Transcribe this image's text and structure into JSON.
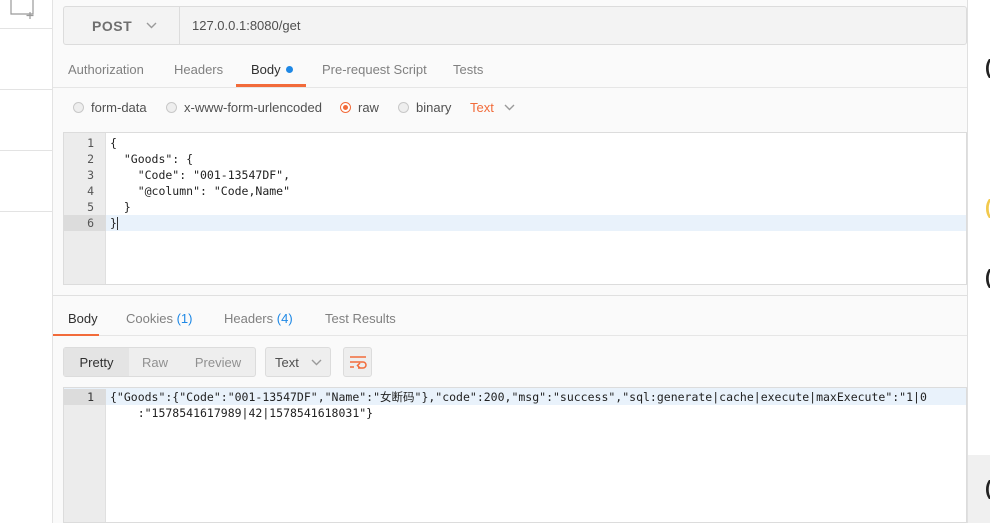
{
  "request": {
    "method": "POST",
    "url": "127.0.0.1:8080/get"
  },
  "request_tabs": [
    {
      "label": "Authorization"
    },
    {
      "label": "Headers"
    },
    {
      "label": "Body"
    },
    {
      "label": "Pre-request Script"
    },
    {
      "label": "Tests"
    }
  ],
  "body_types": [
    {
      "label": "form-data"
    },
    {
      "label": "x-www-form-urlencoded"
    },
    {
      "label": "raw"
    },
    {
      "label": "binary"
    }
  ],
  "raw_format": "Text",
  "editor": {
    "lines": [
      {
        "n": "1",
        "text": "{"
      },
      {
        "n": "2",
        "text": "  \"Goods\": {"
      },
      {
        "n": "3",
        "text": "    \"Code\": \"001-13547DF\","
      },
      {
        "n": "4",
        "text": "    \"@column\": \"Code,Name\""
      },
      {
        "n": "5",
        "text": "  }"
      },
      {
        "n": "6",
        "text": "}"
      }
    ]
  },
  "response_tabs": {
    "body": "Body",
    "cookies": "Cookies",
    "cookies_count": "(1)",
    "headers": "Headers",
    "headers_count": "(4)",
    "tests": "Test Results"
  },
  "view_modes": [
    {
      "label": "Pretty"
    },
    {
      "label": "Raw"
    },
    {
      "label": "Preview"
    }
  ],
  "response_format": "Text",
  "response": {
    "line_number": "1",
    "line1": "{\"Goods\":{\"Code\":\"001-13547DF\",\"Name\":\"女断码\"},\"code\":200,\"msg\":\"success\",\"sql:generate|cache|execute|maxExecute\":\"1|0",
    "line2": "    :\"1578541617989|42|1578541618031\"}"
  },
  "colors": {
    "accent": "#f26b3a",
    "count_blue": "#1e88e5"
  }
}
